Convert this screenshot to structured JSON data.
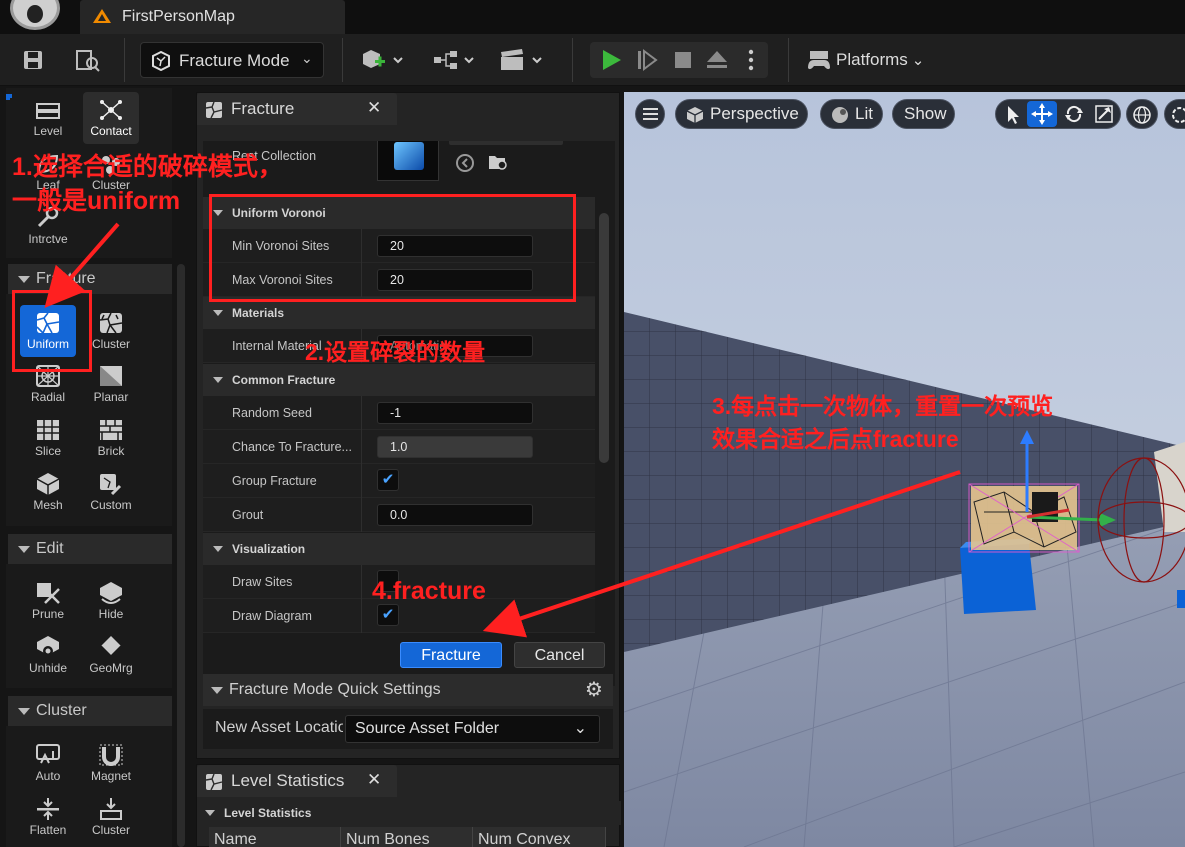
{
  "window": {
    "map_title": "FirstPersonMap"
  },
  "toolbar": {
    "mode_label": "Fracture Mode",
    "platforms_label": "Platforms"
  },
  "palette": {
    "top_items": [
      {
        "label": "Level"
      },
      {
        "label": "Contact"
      },
      {
        "label": "Leaf"
      },
      {
        "label": "Cluster"
      },
      {
        "label": "Intrctve"
      }
    ],
    "sections": {
      "fracture": "Fracture",
      "edit": "Edit",
      "cluster": "Cluster"
    },
    "fracture_items": [
      {
        "label": "Uniform"
      },
      {
        "label": "Cluster"
      },
      {
        "label": "Radial"
      },
      {
        "label": "Planar"
      },
      {
        "label": "Slice"
      },
      {
        "label": "Brick"
      },
      {
        "label": "Mesh"
      },
      {
        "label": "Custom"
      }
    ],
    "edit_items": [
      {
        "label": "Prune"
      },
      {
        "label": "Hide"
      },
      {
        "label": "Unhide"
      },
      {
        "label": "GeoMrg"
      }
    ],
    "cluster_items": [
      {
        "label": "Auto"
      },
      {
        "label": "Magnet"
      },
      {
        "label": "Flatten"
      },
      {
        "label": "Cluster"
      }
    ]
  },
  "fracture_panel": {
    "tab_title": "Fracture",
    "rest_collection_label": "Rest Collection",
    "categories": {
      "uniform_voronoi": "Uniform Voronoi",
      "materials": "Materials",
      "common_fracture": "Common Fracture",
      "visualization": "Visualization"
    },
    "props": {
      "min_sites_label": "Min Voronoi Sites",
      "min_sites_value": "20",
      "max_sites_label": "Max Voronoi Sites",
      "max_sites_value": "20",
      "internal_material_label": "Internal Material",
      "internal_material_value": "Automatic",
      "random_seed_label": "Random Seed",
      "random_seed_value": "-1",
      "chance_label": "Chance To Fracture...",
      "chance_value": "1.0",
      "group_fracture_label": "Group Fracture",
      "group_fracture_checked": true,
      "grout_label": "Grout",
      "grout_value": "0.0",
      "draw_sites_label": "Draw Sites",
      "draw_sites_checked": false,
      "draw_diagram_label": "Draw Diagram",
      "draw_diagram_checked": true
    },
    "buttons": {
      "fracture": "Fracture",
      "cancel": "Cancel"
    },
    "quick_settings": {
      "header": "Fracture Mode Quick Settings",
      "new_asset_label": "New Asset Location",
      "new_asset_value": "Source Asset Folder"
    }
  },
  "level_stats": {
    "tab_title": "Level Statistics",
    "category": "Level Statistics",
    "columns": [
      "Name",
      "Num Bones",
      "Num Convex"
    ]
  },
  "viewport": {
    "perspective_label": "Perspective",
    "lit_label": "Lit",
    "show_label": "Show"
  },
  "annotations": {
    "step1_line1": "1.选择合适的破碎模式，",
    "step1_line2": "一般是uniform",
    "step2": "2.设置碎裂的数量",
    "step3_line1": "3.每点击一次物体，重置一次预览",
    "step3_line2": "效果合适之后点fracture",
    "step4": "4.fracture"
  },
  "colors": {
    "accent": "#1467d7",
    "annotation": "#ff2020"
  }
}
